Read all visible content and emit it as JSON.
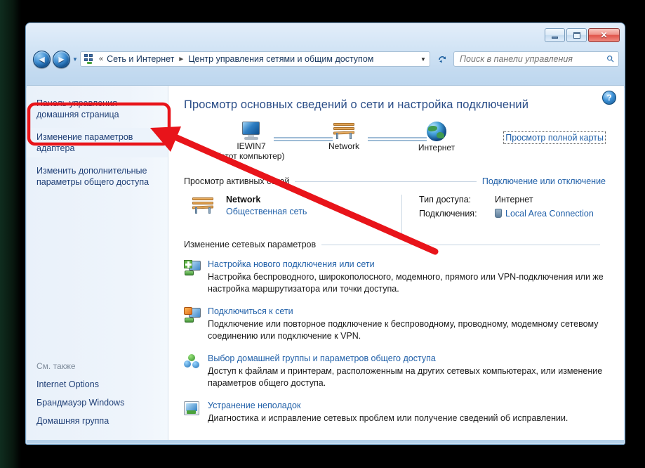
{
  "window": {
    "controls": {
      "minimize": "—",
      "maximize": "□",
      "close": "✕"
    }
  },
  "addressbar": {
    "back": "◄",
    "forward": "►",
    "chevron": "«",
    "crumb1": "Сеть и Интернет",
    "separator": "►",
    "crumb2": "Центр управления сетями и общим доступом",
    "dropdown": "▼",
    "refresh": "↻"
  },
  "search": {
    "placeholder": "Поиск в панели управления",
    "value": "",
    "icon": "⌕"
  },
  "sidebar": {
    "links": [
      "Панель управления - домашняя страница",
      "Изменение параметров адаптера",
      "Изменить дополнительные параметры общего доступа"
    ],
    "see_also_title": "См. также",
    "see_also": [
      "Internet Options",
      "Брандмауэр Windows",
      "Домашняя группа"
    ]
  },
  "help": {
    "glyph": "?"
  },
  "main": {
    "page_title": "Просмотр основных сведений о сети и настройка подключений",
    "map": {
      "nodes": [
        {
          "label": "IEWIN7",
          "sub": "(этот компьютер)"
        },
        {
          "label": "Network",
          "sub": ""
        },
        {
          "label": "Интернет",
          "sub": ""
        }
      ],
      "full_map_link": "Просмотр полной карты"
    },
    "active_networks": {
      "title": "Просмотр активных сетей",
      "action": "Подключение или отключение",
      "network_name": "Network",
      "network_type": "Общественная сеть",
      "access_type_key": "Тип доступа:",
      "access_type_value": "Интернет",
      "connections_key": "Подключения:",
      "connections_value": "Local Area Connection"
    },
    "change_settings": {
      "title": "Изменение сетевых параметров",
      "items": [
        {
          "title": "Настройка нового подключения или сети",
          "desc": "Настройка беспроводного, широкополосного, модемного, прямого или VPN-подключения или же настройка маршрутизатора или точки доступа."
        },
        {
          "title": "Подключиться к сети",
          "desc": "Подключение или повторное подключение к беспроводному, проводному, модемному сетевому соединению или подключение к VPN."
        },
        {
          "title": "Выбор домашней группы и параметров общего доступа",
          "desc": "Доступ к файлам и принтерам, расположенным на других сетевых компьютерах, или изменение параметров общего доступа."
        },
        {
          "title": "Устранение неполадок",
          "desc": "Диагностика и исправление сетевых проблем или получение сведений об исправлении."
        }
      ]
    }
  },
  "annotation": {
    "color": "#e8141a",
    "target": "Изменение параметров адаптера"
  }
}
